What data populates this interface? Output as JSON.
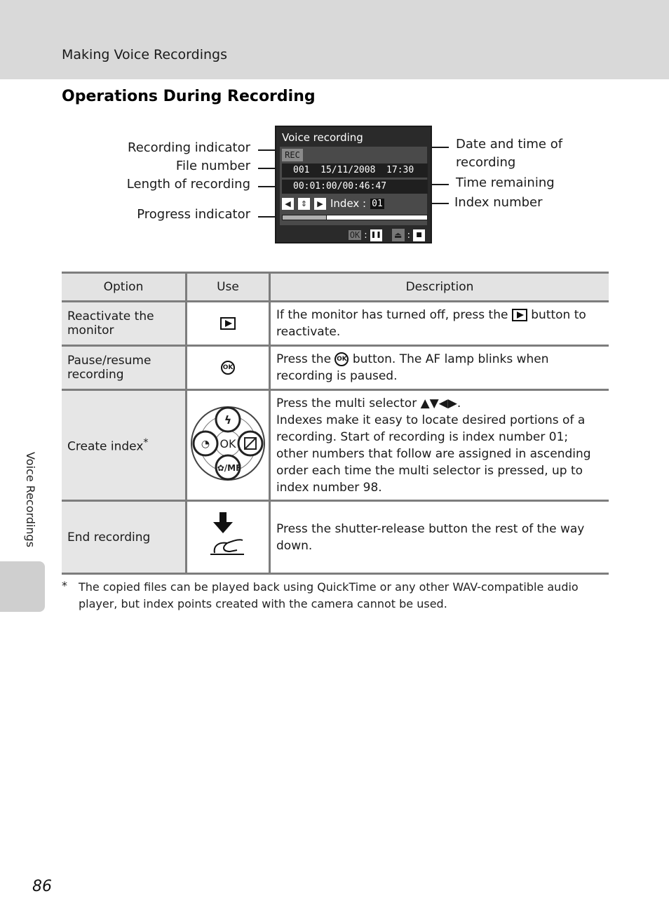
{
  "header": {
    "section": "Making Voice Recordings",
    "title": "Operations During Recording"
  },
  "diagram": {
    "screen_title": "Voice recording",
    "rec_badge": "REC",
    "file_datetime": "001  15/11/2008  17:30",
    "length_remaining": "00:01:00/00:46:47",
    "index_label": "Index :",
    "index_value": "01",
    "progress_fraction": 0.3,
    "ok_chip": "OK",
    "colon": ":",
    "callouts_left": [
      "Recording indicator",
      "File number",
      "Length of recording",
      "Progress indicator"
    ],
    "callouts_right": [
      "Date and time of recording",
      "Time remaining",
      "Index number"
    ]
  },
  "table": {
    "headers": [
      "Option",
      "Use",
      "Description"
    ],
    "rows": [
      {
        "option": "Reactivate the monitor",
        "use_icon": "playback-button-icon",
        "desc_before": "If the monitor has turned off, press the",
        "desc_after": "button to reactivate."
      },
      {
        "option": "Pause/resume recording",
        "use_icon": "ok-button-icon",
        "desc_before": "Press the",
        "desc_after": "button. The AF lamp blinks when recording is paused."
      },
      {
        "option": "Create index",
        "option_mark": "*",
        "use_icon": "multi-selector-icon",
        "desc_line1": "Press the multi selector ▲▼◀▶.",
        "desc_line2": "Indexes make it easy to locate desired portions of a recording. Start of recording is index number 01; other numbers that follow are assigned in ascending order each time the multi selector is pressed, up to index number 98."
      },
      {
        "option": "End recording",
        "use_icon": "shutter-release-press-icon",
        "desc": "Press the shutter-release button the rest of the way down."
      }
    ]
  },
  "multi_selector": {
    "center": "OK",
    "bottom": "✿/MF"
  },
  "footnote": {
    "mark": "*",
    "text": "The copied files can be played back using QuickTime or any other WAV-compatible audio player, but index points created with the camera cannot be used."
  },
  "side_tab_label": "Voice Recordings",
  "page_number": "86"
}
